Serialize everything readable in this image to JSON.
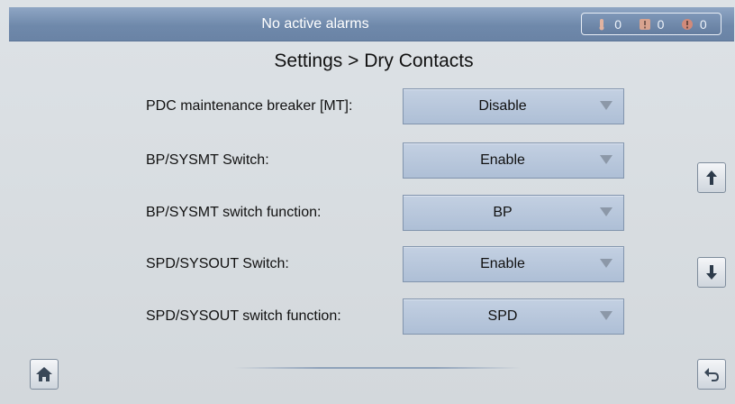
{
  "header": {
    "alarm_status": "No active alarms",
    "counters": [
      {
        "icon": "minor-alarm-icon",
        "count": "0",
        "color": "#e7b7a3"
      },
      {
        "icon": "major-alarm-icon",
        "count": "0",
        "color": "#d8a38f"
      },
      {
        "icon": "critical-alarm-icon",
        "count": "0",
        "color": "#d18a7a"
      }
    ]
  },
  "page": {
    "title": "Settings > Dry Contacts"
  },
  "settings": [
    {
      "label": "PDC maintenance breaker [MT]:",
      "value": "Disable"
    },
    {
      "label": "BP/SYSMT Switch:",
      "value": "Enable"
    },
    {
      "label": "BP/SYSMT switch function:",
      "value": "BP"
    },
    {
      "label": "SPD/SYSOUT Switch:",
      "value": "Enable"
    },
    {
      "label": "SPD/SYSOUT switch function:",
      "value": "SPD"
    }
  ],
  "nav": {
    "up_icon": "arrow-up-icon",
    "down_icon": "arrow-down-icon",
    "home_icon": "home-icon",
    "back_icon": "back-icon"
  }
}
